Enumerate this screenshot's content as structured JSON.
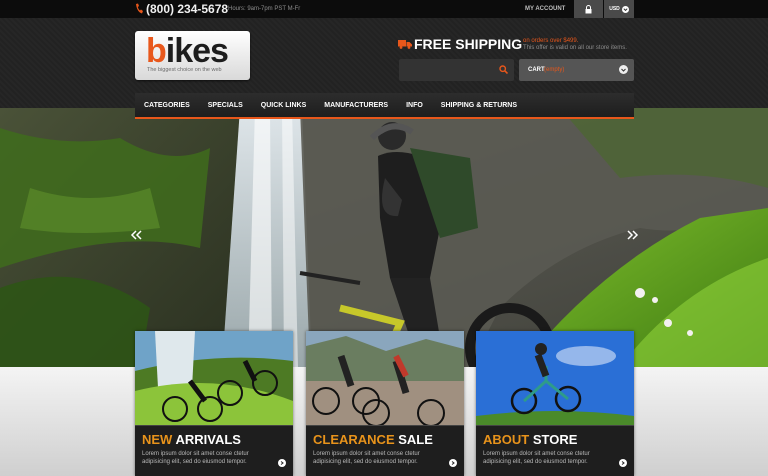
{
  "topbar": {
    "phone": "(800) 234-5678",
    "hours": "Hours: 9am-7pm PST M-Fr",
    "my_account": "MY ACCOUNT",
    "currency": "USD"
  },
  "logo": {
    "word_accent": "b",
    "word_rest": "ikes",
    "tagline": "The biggest choice on the web"
  },
  "shipping": {
    "title": "FREE SHIPPING",
    "line1": "on orders over $499.",
    "line2": "This offer is valid on all our store items."
  },
  "search": {
    "placeholder": ""
  },
  "cart": {
    "label": "CART",
    "status": "(empty)"
  },
  "nav": {
    "items": [
      "CATEGORIES",
      "SPECIALS",
      "QUICK LINKS",
      "MANUFACTURERS",
      "INFO",
      "SHIPPING & RETURNS"
    ]
  },
  "cards": [
    {
      "accent": "NEW",
      "rest": " ARRIVALS",
      "text": "Lorem ipsum dolor sit amet conse ctetur adipisicing elit, sed do eiusmod tempor."
    },
    {
      "accent": "CLEARANCE",
      "rest": " SALE",
      "text": "Lorem ipsum dolor sit amet conse ctetur adipisicing elit, sed do eiusmod tempor."
    },
    {
      "accent": "ABOUT",
      "rest": " STORE",
      "text": "Lorem ipsum dolor sit amet conse ctetur adipisicing elit, sed do eiusmod tempor."
    }
  ],
  "colors": {
    "accent": "#e8571b",
    "card_accent": "#e8931b"
  },
  "icons": [
    "phone-icon",
    "lock-icon",
    "chevron-down-icon",
    "truck-icon",
    "search-icon",
    "arrow-left-icon",
    "arrow-right-icon",
    "arrow-right-circle-icon"
  ]
}
